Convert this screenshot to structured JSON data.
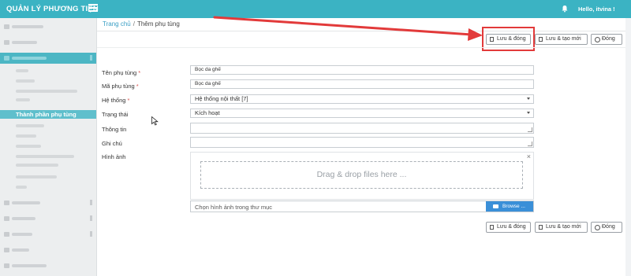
{
  "header": {
    "app_title": "QUẢN LÝ PHƯƠNG TIỆN",
    "user_greeting": "Hello, itvina !",
    "menu_icon": "hamburger-icon",
    "bell_icon": "bell-icon",
    "color": "#3bb3c3"
  },
  "breadcrumb": {
    "home": "Trang chủ",
    "separator": "/",
    "current": "Thêm phụ tùng"
  },
  "sidebar": {
    "active_sub_item": "Thành phần phụ tùng",
    "active_color": "#4cb6c4"
  },
  "toolbar": {
    "save_close": "Lưu & đóng",
    "save_new": "Lưu & tạo mới",
    "close": "Đóng"
  },
  "form": {
    "name_label": "Tên phụ tùng",
    "name_value": "Bọc da ghế",
    "code_label": "Mã phụ tùng",
    "code_value": "Bọc da ghế",
    "system_label": "Hệ thống",
    "system_value": "Hệ thống nội thất [7]",
    "status_label": "Trạng thái",
    "status_value": "Kích hoạt",
    "info_label": "Thông tin",
    "note_label": "Ghi chú",
    "image_label": "Hình ảnh",
    "required_mark": "*"
  },
  "upload": {
    "dropzone_text": "Drag & drop files here ...",
    "close_icon": "×",
    "file_placeholder": "Chọn hình ảnh trong thư mục",
    "browse_label": "Browse ...",
    "browse_color": "#3a8fd8"
  },
  "annotation": {
    "arrow_color": "#e23a3a"
  }
}
